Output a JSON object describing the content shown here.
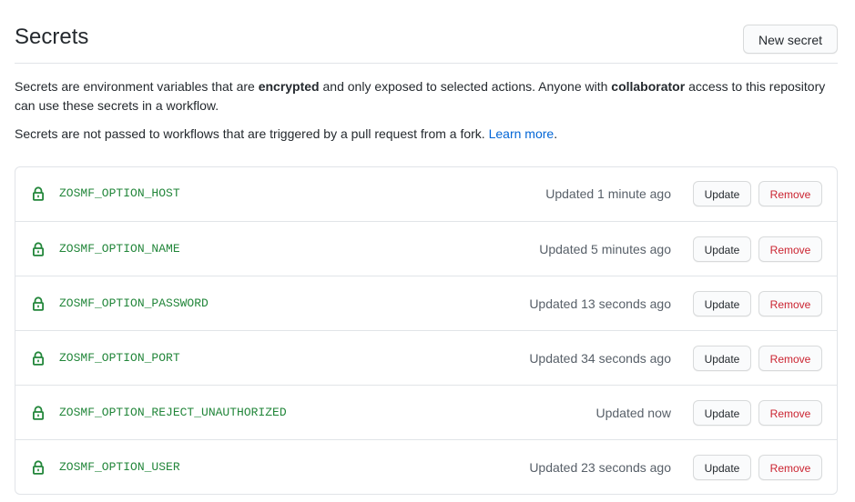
{
  "header": {
    "title": "Secrets",
    "new_secret_label": "New secret"
  },
  "description": {
    "p1_part1": "Secrets are environment variables that are ",
    "p1_bold1": "encrypted",
    "p1_part2": " and only exposed to selected actions. Anyone with ",
    "p1_bold2": "collaborator",
    "p1_part3": " access to this repository can use these secrets in a workflow.",
    "p2_text": "Secrets are not passed to workflows that are triggered by a pull request from a fork. ",
    "p2_link": "Learn more",
    "p2_end": "."
  },
  "secrets": [
    {
      "name": "ZOSMF_OPTION_HOST",
      "updated": "Updated 1 minute ago",
      "update_label": "Update",
      "remove_label": "Remove"
    },
    {
      "name": "ZOSMF_OPTION_NAME",
      "updated": "Updated 5 minutes ago",
      "update_label": "Update",
      "remove_label": "Remove"
    },
    {
      "name": "ZOSMF_OPTION_PASSWORD",
      "updated": "Updated 13 seconds ago",
      "update_label": "Update",
      "remove_label": "Remove"
    },
    {
      "name": "ZOSMF_OPTION_PORT",
      "updated": "Updated 34 seconds ago",
      "update_label": "Update",
      "remove_label": "Remove"
    },
    {
      "name": "ZOSMF_OPTION_REJECT_UNAUTHORIZED",
      "updated": "Updated now",
      "update_label": "Update",
      "remove_label": "Remove"
    },
    {
      "name": "ZOSMF_OPTION_USER",
      "updated": "Updated 23 seconds ago",
      "update_label": "Update",
      "remove_label": "Remove"
    }
  ],
  "icons": {
    "lock": "lock-icon"
  },
  "colors": {
    "secret_name": "#22863a",
    "link": "#0366d6",
    "remove": "#cb2431",
    "muted": "#586069",
    "border": "#e1e4e8"
  }
}
